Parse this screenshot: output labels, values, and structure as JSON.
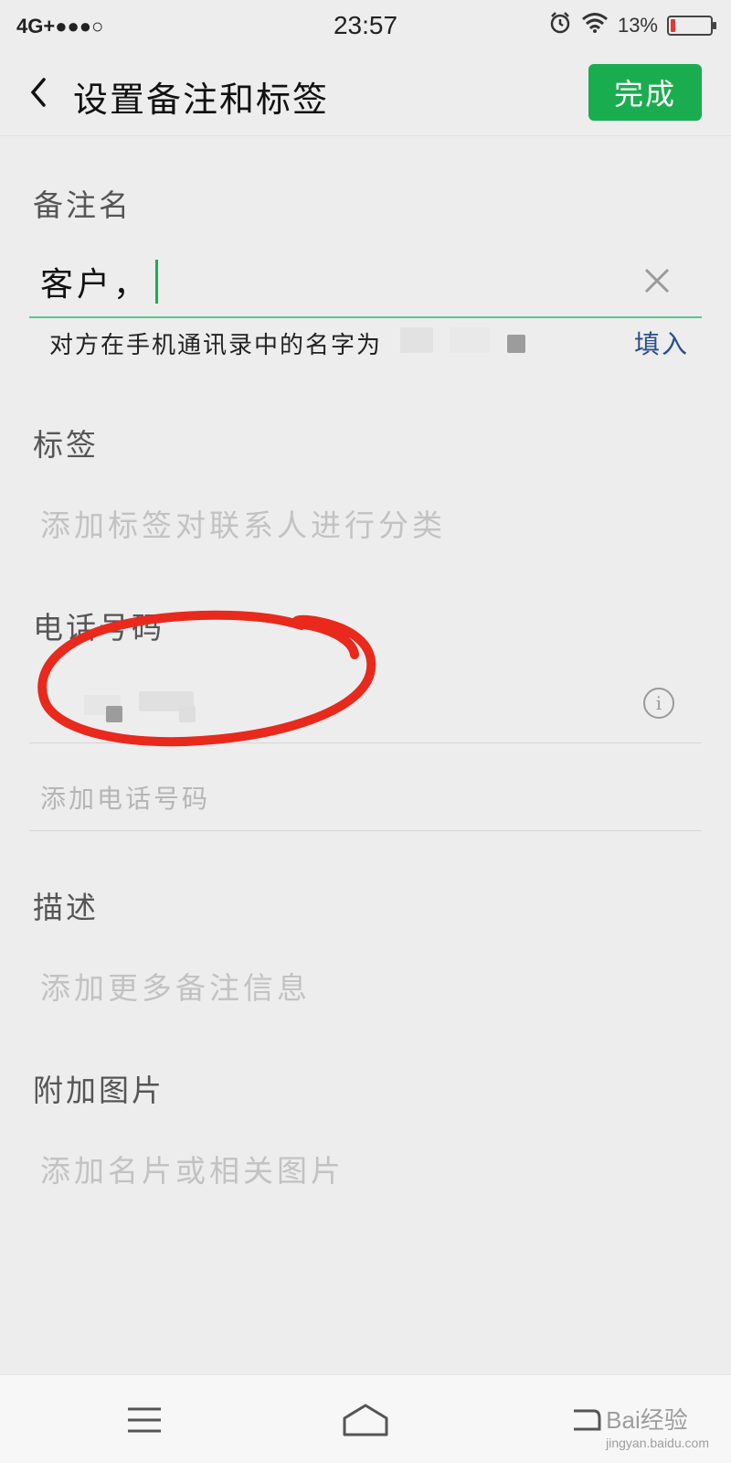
{
  "status_bar": {
    "network": "4G+●●●○",
    "time": "23:57",
    "battery_text": "13%",
    "battery_level": 0.13
  },
  "nav": {
    "title": "设置备注和标签",
    "done_label": "完成"
  },
  "remark": {
    "label": "备注名",
    "value": "客户，",
    "hint": "对方在手机通讯录中的名字为",
    "fill_label": "填入"
  },
  "tags": {
    "label": "标签",
    "placeholder": "添加标签对联系人进行分类"
  },
  "phone": {
    "label": "电话号码",
    "add_label": "添加电话号码"
  },
  "description": {
    "label": "描述",
    "placeholder": "添加更多备注信息"
  },
  "attach": {
    "label": "附加图片",
    "placeholder": "添加名片或相关图片"
  },
  "watermark": {
    "text": "Bai经验",
    "sub": "jingyan.baidu.com"
  },
  "colors": {
    "accent": "#1aad4f",
    "annotation": "#e8291c",
    "link": "#2a4e8a"
  }
}
